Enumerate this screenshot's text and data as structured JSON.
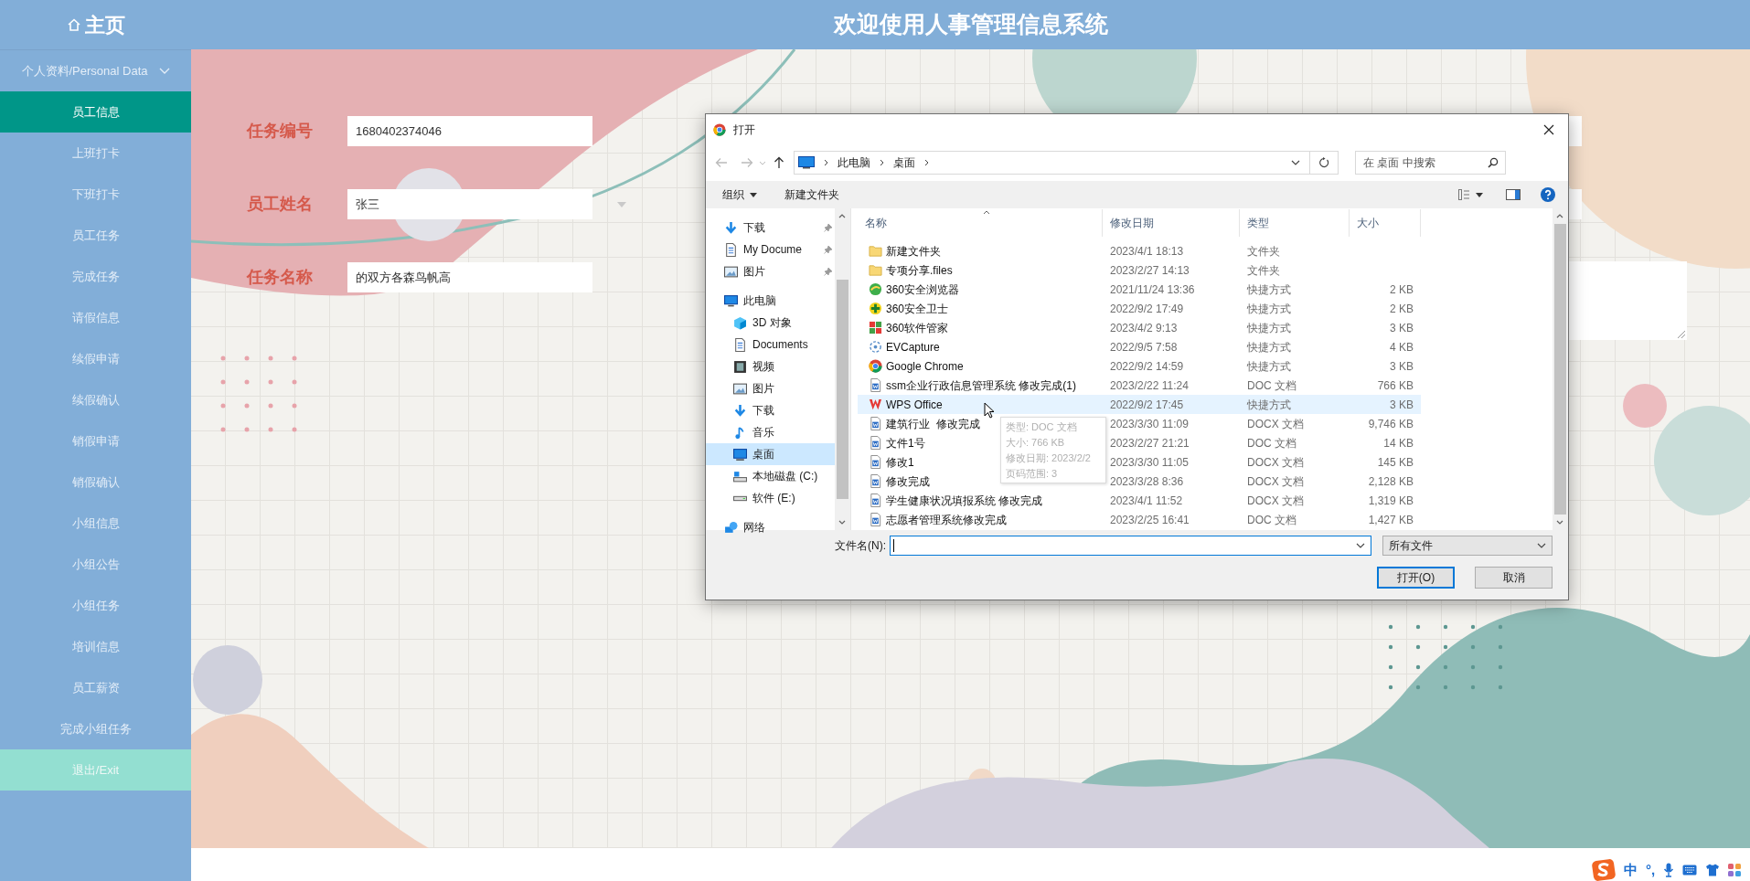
{
  "header": {
    "home_label": "主页",
    "title": "欢迎使用人事管理信息系统"
  },
  "sidebar": {
    "group": {
      "label": "个人资料/Personal Data",
      "expanded": true
    },
    "items": [
      {
        "label": "员工信息",
        "selected": true,
        "kind": "link"
      },
      {
        "label": "上班打卡",
        "selected": false,
        "kind": "link"
      },
      {
        "label": "下班打卡",
        "selected": false,
        "kind": "link"
      },
      {
        "label": "员工任务",
        "selected": false,
        "kind": "link"
      },
      {
        "label": "完成任务",
        "selected": false,
        "kind": "link"
      },
      {
        "label": "请假信息",
        "selected": false,
        "kind": "link"
      },
      {
        "label": "续假申请",
        "selected": false,
        "kind": "link"
      },
      {
        "label": "续假确认",
        "selected": false,
        "kind": "link"
      },
      {
        "label": "销假申请",
        "selected": false,
        "kind": "link"
      },
      {
        "label": "销假确认",
        "selected": false,
        "kind": "link"
      },
      {
        "label": "小组信息",
        "selected": false,
        "kind": "link"
      },
      {
        "label": "小组公告",
        "selected": false,
        "kind": "link"
      },
      {
        "label": "小组任务",
        "selected": false,
        "kind": "link"
      },
      {
        "label": "培训信息",
        "selected": false,
        "kind": "link"
      },
      {
        "label": "员工薪资",
        "selected": false,
        "kind": "link"
      },
      {
        "label": "完成小组任务",
        "selected": false,
        "kind": "link"
      },
      {
        "label": "退出/Exit",
        "selected": false,
        "kind": "exit"
      }
    ]
  },
  "form": {
    "fields": [
      {
        "label": "任务编号",
        "value": "1680402374046"
      },
      {
        "label": "员工姓名",
        "value": "张三"
      },
      {
        "label": "任务名称",
        "value": "的双方各森鸟帆高"
      }
    ]
  },
  "dialog": {
    "title": "打开",
    "path": [
      "此电脑",
      "桌面"
    ],
    "search": {
      "placeholder": "在 桌面 中搜索"
    },
    "toolbar": [
      {
        "label": "组织",
        "kind": "menu"
      },
      {
        "label": "新建文件夹",
        "kind": "plain"
      }
    ],
    "nav": [
      {
        "label": "下载",
        "kind": "download",
        "pinned": true,
        "selected": false
      },
      {
        "label": "My Docume",
        "kind": "doc",
        "pinned": true,
        "selected": false
      },
      {
        "label": "图片",
        "kind": "image",
        "pinned": true,
        "selected": false
      },
      {
        "label": "此电脑",
        "kind": "pc",
        "pinned": false,
        "selected": false,
        "children": [
          {
            "label": "3D 对象",
            "kind": "cube",
            "pinned": false,
            "selected": false
          },
          {
            "label": "Documents",
            "kind": "doc",
            "pinned": false,
            "selected": false
          },
          {
            "label": "视频",
            "kind": "video",
            "pinned": false,
            "selected": false
          },
          {
            "label": "图片",
            "kind": "image",
            "pinned": false,
            "selected": false
          },
          {
            "label": "下载",
            "kind": "download",
            "pinned": false,
            "selected": false
          },
          {
            "label": "音乐",
            "kind": "music",
            "pinned": false,
            "selected": false
          },
          {
            "label": "桌面",
            "kind": "desktop",
            "pinned": false,
            "selected": true
          },
          {
            "label": "本地磁盘 (C:)",
            "kind": "disk",
            "pinned": false,
            "selected": false
          },
          {
            "label": "软件 (E:)",
            "kind": "drive",
            "pinned": false,
            "selected": false
          }
        ]
      },
      {
        "label": "网络",
        "kind": "network",
        "pinned": false,
        "selected": false
      }
    ],
    "columns": [
      "名称",
      "修改日期",
      "类型",
      "大小"
    ],
    "files": [
      {
        "name": "新建文件夹",
        "date": "2023/4/1 18:13",
        "type": "文件夹",
        "kind": "folder",
        "hovered": false
      },
      {
        "name": "专项分享.files",
        "date": "2023/2/27 14:13",
        "type": "文件夹",
        "kind": "folder",
        "hovered": false
      },
      {
        "name": "360安全浏览器",
        "date": "2021/11/24 13:36",
        "type": "快捷方式",
        "size": "2 KB",
        "kind": "globe",
        "hovered": false
      },
      {
        "name": "360安全卫士",
        "date": "2022/9/2 17:49",
        "type": "快捷方式",
        "size": "2 KB",
        "kind": "shield",
        "hovered": false
      },
      {
        "name": "360软件管家",
        "date": "2023/4/2 9:13",
        "type": "快捷方式",
        "size": "3 KB",
        "kind": "tiles",
        "hovered": false
      },
      {
        "name": "EVCapture",
        "date": "2022/9/5 7:58",
        "type": "快捷方式",
        "size": "4 KB",
        "kind": "capture",
        "hovered": false
      },
      {
        "name": "Google Chrome",
        "date": "2022/9/2 14:59",
        "type": "快捷方式",
        "size": "3 KB",
        "kind": "chrome",
        "hovered": false
      },
      {
        "name": "ssm企业行政信息管理系统 修改完成(1)",
        "date": "2023/2/22 11:24",
        "type": "DOC 文档",
        "size": "766 KB",
        "kind": "word",
        "hovered": false
      },
      {
        "name": "WPS Office",
        "date": "2022/9/2 17:45",
        "type": "快捷方式",
        "size": "3 KB",
        "kind": "wps",
        "hovered": true
      },
      {
        "name": "建筑行业  修改完成",
        "date": "2023/3/30 11:09",
        "type": "DOCX 文档",
        "size": "9,746 KB",
        "kind": "word",
        "hovered": false
      },
      {
        "name": "文件1号",
        "date": "2023/2/27 21:21",
        "type": "DOC 文档",
        "size": "14 KB",
        "kind": "word",
        "hovered": false
      },
      {
        "name": "修改1",
        "date": "2023/3/30 11:05",
        "type": "DOCX 文档",
        "size": "145 KB",
        "kind": "word",
        "hovered": false
      },
      {
        "name": "修改完成",
        "date": "2023/3/28 8:36",
        "type": "DOCX 文档",
        "size": "2,128 KB",
        "kind": "word",
        "hovered": false
      },
      {
        "name": "学生健康状况填报系统 修改完成",
        "date": "2023/4/1 11:52",
        "type": "DOCX 文档",
        "size": "1,319 KB",
        "kind": "word",
        "hovered": false
      },
      {
        "name": "志愿者管理系统修改完成",
        "date": "2023/2/25 16:41",
        "type": "DOC 文档",
        "size": "1,427 KB",
        "kind": "word",
        "hovered": false
      }
    ],
    "tooltip": [
      "类型: DOC 文档",
      "大小: 766 KB",
      "修改日期: 2023/2/2",
      "页码范围: 3"
    ],
    "filename_label": "文件名(N):",
    "filter": "所有文件",
    "buttons": [
      {
        "label": "打开(O)",
        "kind": "default"
      },
      {
        "label": "取消",
        "kind": "normal"
      }
    ]
  },
  "ime": {
    "mode": "中",
    "punct": "°,"
  }
}
